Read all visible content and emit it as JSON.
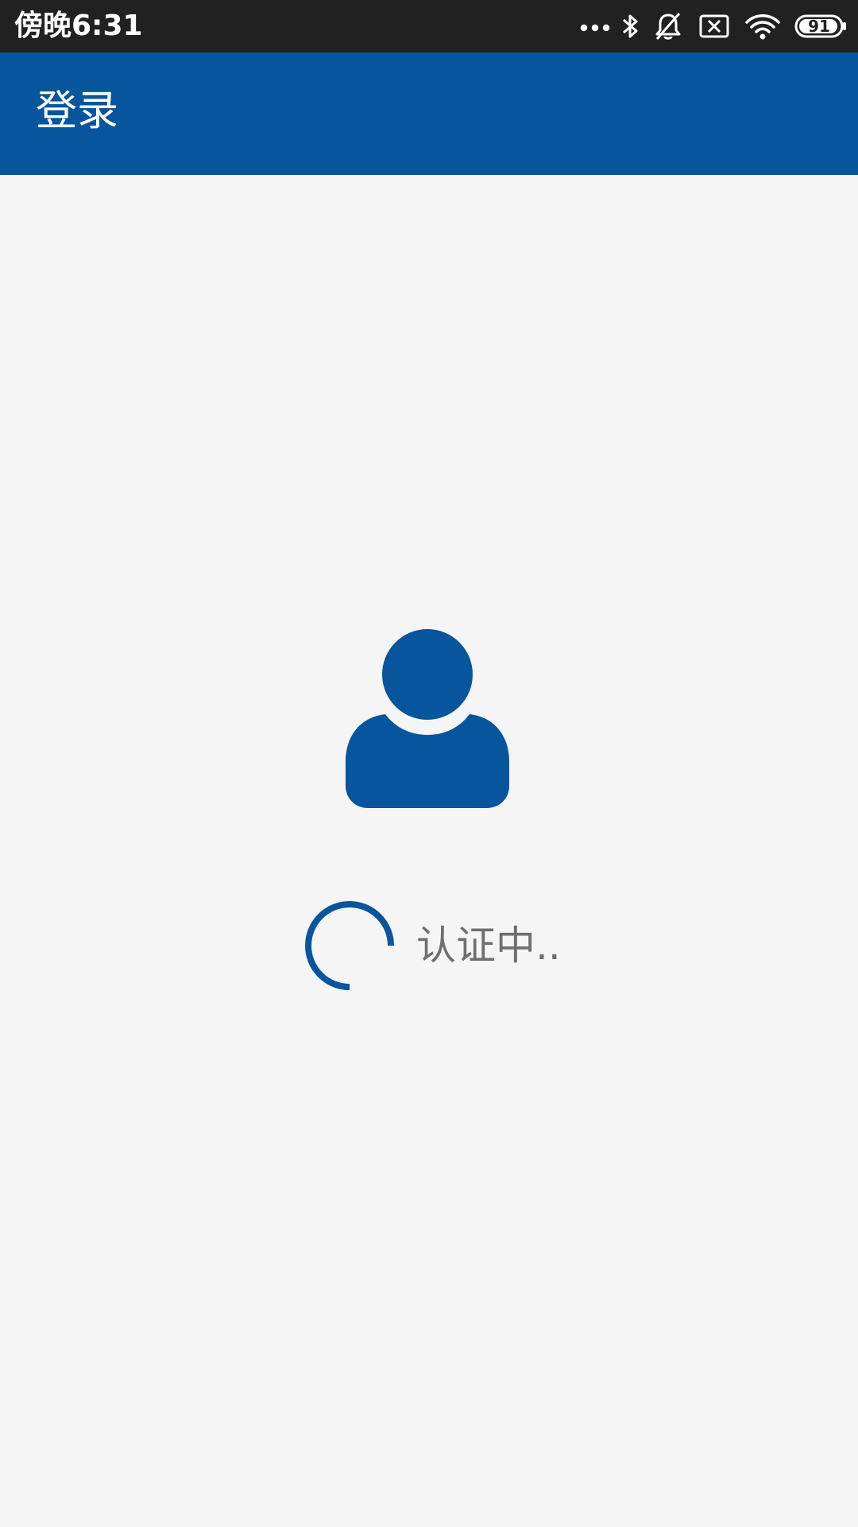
{
  "status_bar": {
    "time": "傍晚6:31",
    "battery_level": "91",
    "icons": [
      "more-dots-icon",
      "bluetooth-icon",
      "notifications-off-icon",
      "sim-disabled-icon",
      "wifi-icon",
      "battery-icon"
    ]
  },
  "app_bar": {
    "title": "登录"
  },
  "main": {
    "avatar_icon": "user-avatar-icon",
    "loading_text": "认证中..",
    "spinner_icon": "loading-spinner-icon"
  },
  "colors": {
    "primary": "#07559c",
    "status_bar": "#212121",
    "background": "#f5f5f6",
    "loading_text": "#6f6f6f"
  }
}
